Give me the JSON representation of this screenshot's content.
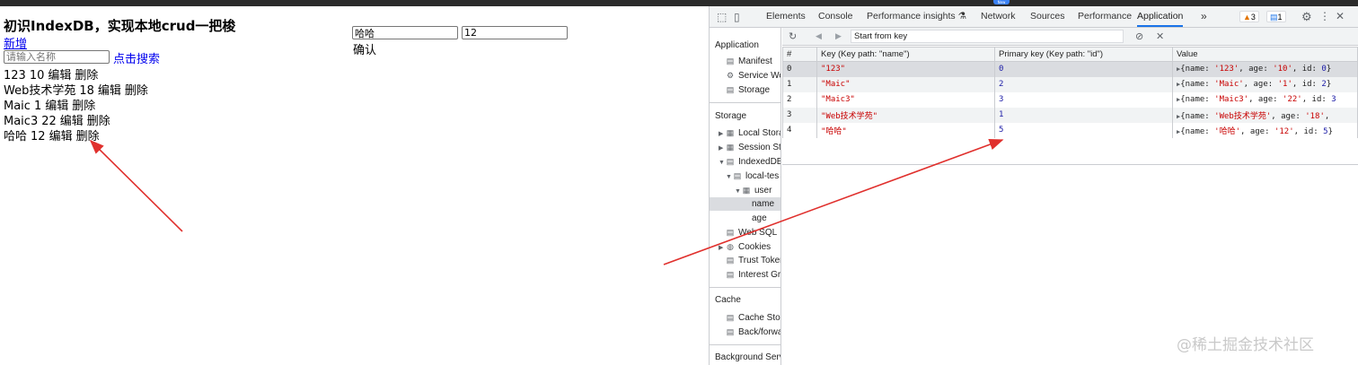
{
  "page": {
    "title": "初识IndexDB，实现本地crud一把梭",
    "add_link": "新增",
    "search_placeholder": "请输入名称",
    "search_link": "点击搜索",
    "rows": [
      {
        "name": "123",
        "age": "10",
        "edit": "编辑",
        "delete": "删除"
      },
      {
        "name": "Web技术学苑",
        "age": "18",
        "edit": "编辑",
        "delete": "删除"
      },
      {
        "name": "Maic",
        "age": "1",
        "edit": "编辑",
        "delete": "删除"
      },
      {
        "name": "Maic3",
        "age": "22",
        "edit": "编辑",
        "delete": "删除"
      },
      {
        "name": "哈哈",
        "age": "12",
        "edit": "编辑",
        "delete": "删除"
      }
    ],
    "form": {
      "name_value": "哈哈",
      "age_value": "12",
      "confirm": "确认"
    }
  },
  "devtools": {
    "tabs": [
      "Elements",
      "Console",
      "Performance insights",
      "Network",
      "Sources",
      "Performance",
      "Application"
    ],
    "active_tab": "Application",
    "more": "»",
    "warnings": "3",
    "messages": "1",
    "top_badge": "New",
    "sidebar": {
      "application_head": "Application",
      "application_items": [
        "Manifest",
        "Service Wo",
        "Storage"
      ],
      "storage_head": "Storage",
      "storage_items": [
        "Local Stora",
        "Session St",
        "IndexedDB",
        "local-tes",
        "user",
        "name",
        "age",
        "Web SQL",
        "Cookies",
        "Trust Toker",
        "Interest Gr"
      ],
      "cache_head": "Cache",
      "cache_items": [
        "Cache Sto",
        "Back/forwa"
      ],
      "background_head": "Background Serv"
    },
    "key_placeholder": "Start from key",
    "table": {
      "headers": [
        "#",
        "Key (Key path: \"name\")",
        "Primary key (Key path: \"id\")",
        "Value"
      ],
      "rows": [
        {
          "idx": "0",
          "key": "\"123\"",
          "pk": "0",
          "v_name": "'123'",
          "v_age": "'10'",
          "v_id": "0",
          "v_end": "}"
        },
        {
          "idx": "1",
          "key": "\"Maic\"",
          "pk": "2",
          "v_name": "'Maic'",
          "v_age": "'1'",
          "v_id": "2",
          "v_end": "}"
        },
        {
          "idx": "2",
          "key": "\"Maic3\"",
          "pk": "3",
          "v_name": "'Maic3'",
          "v_age": "'22'",
          "v_id": "3",
          "v_end": ""
        },
        {
          "idx": "3",
          "key": "\"Web技术学苑\"",
          "pk": "1",
          "v_name": "'Web技术学苑'",
          "v_age": "'18'",
          "v_id": "",
          "v_end": ""
        },
        {
          "idx": "4",
          "key": "\"哈哈\"",
          "pk": "5",
          "v_name": "'哈哈'",
          "v_age": "'12'",
          "v_id": "5",
          "v_end": "}"
        }
      ]
    }
  },
  "watermark": "@稀土掘金技术社区",
  "colors": {
    "accent": "#1a73e8",
    "link": "#0000ee",
    "arrow": "#e0302d",
    "string": "#c80000",
    "number": "#1a1aa6"
  }
}
